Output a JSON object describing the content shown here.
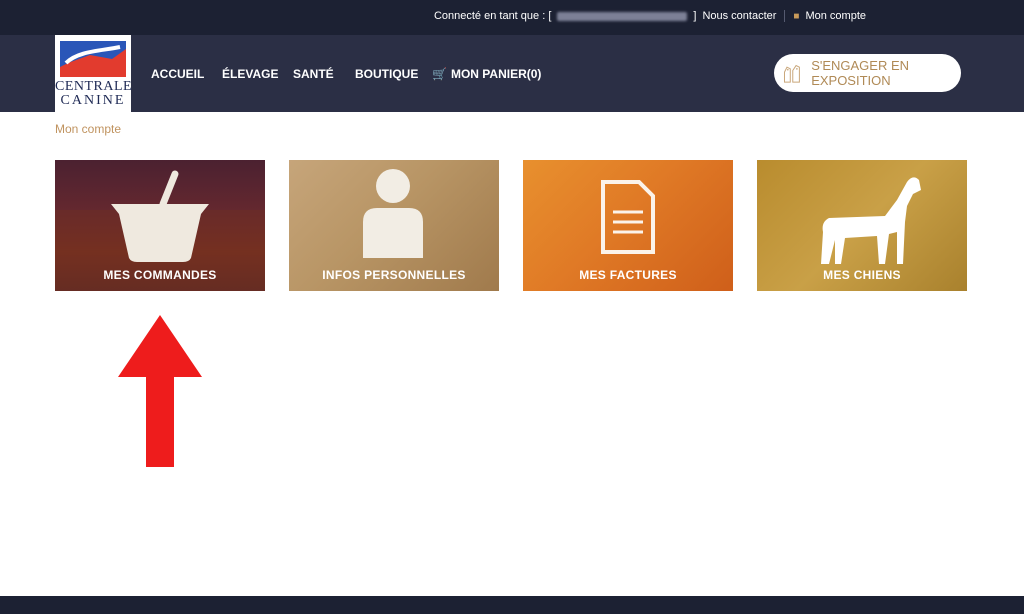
{
  "topbar": {
    "connected_label": "Connecté en tant que : [",
    "connected_close": "]",
    "contact": "Nous contacter",
    "account": "Mon compte"
  },
  "logo": {
    "line1": "CENTRALE",
    "line2": "CANINE"
  },
  "nav": {
    "items": [
      "ACCUEIL",
      "ÉLEVAGE",
      "SANTÉ",
      "BOUTIQUE"
    ],
    "cart": "MON PANIER(0)"
  },
  "engage_button": "S'ENGAGER EN EXPOSITION",
  "breadcrumb": "Mon compte",
  "tiles": [
    {
      "label": "MES COMMANDES",
      "icon": "basket-icon"
    },
    {
      "label": "INFOS PERSONNELLES",
      "icon": "person-icon"
    },
    {
      "label": "MES FACTURES",
      "icon": "document-icon"
    },
    {
      "label": "MES CHIENS",
      "icon": "dog-icon"
    }
  ],
  "colors": {
    "topbar": "#1c2133",
    "navbar": "#2b2f45",
    "accent": "#c0935f",
    "arrow": "#ee1c1c"
  }
}
